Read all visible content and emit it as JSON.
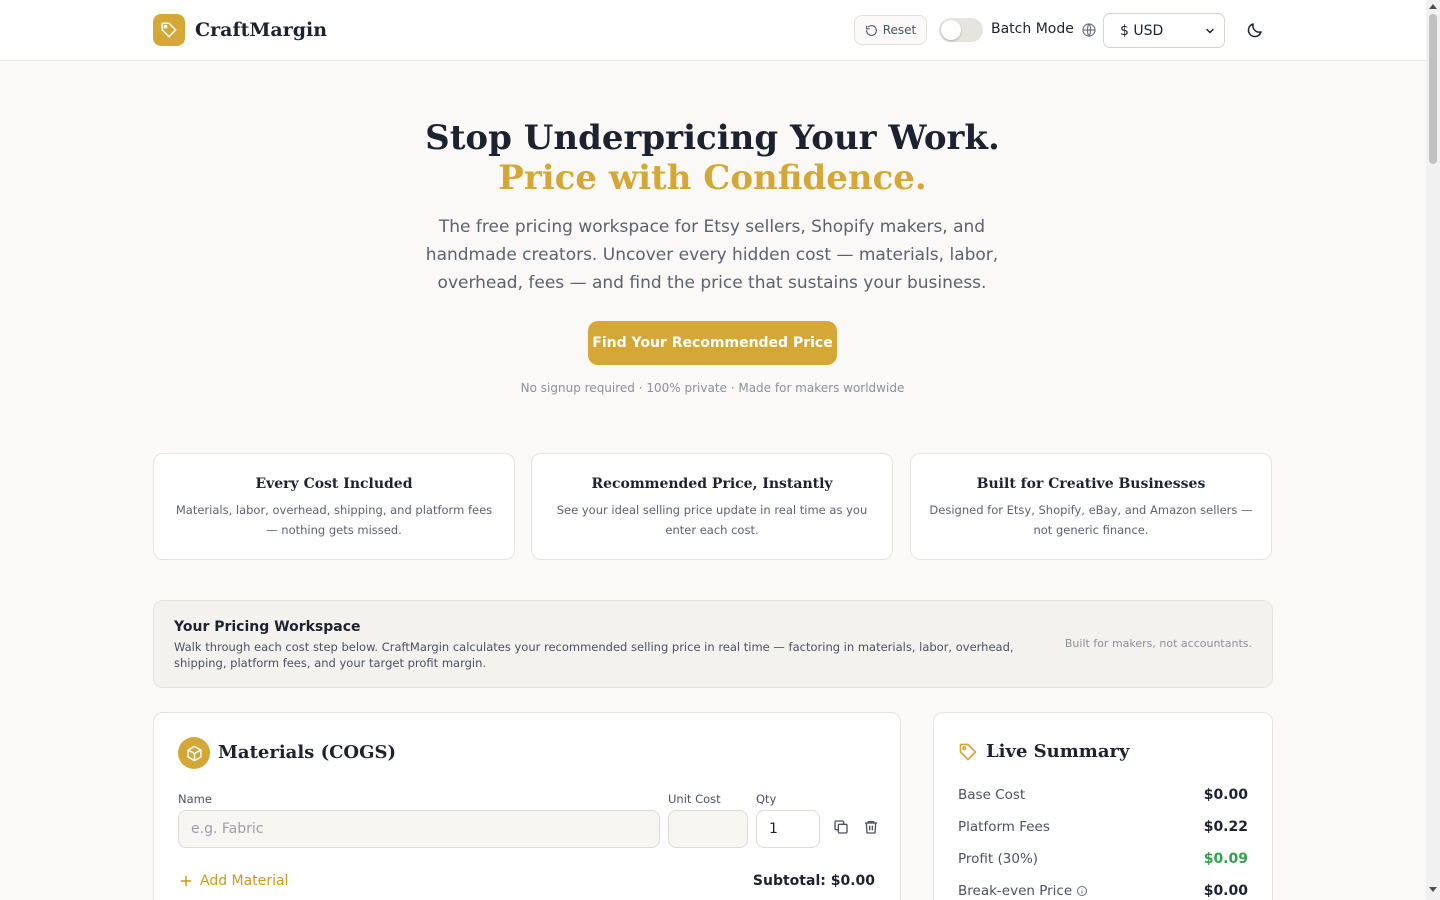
{
  "colors": {
    "accent": "#d4a736",
    "profit_green": "#2fa14f"
  },
  "header": {
    "brand": "CraftMargin",
    "reset_label": "Reset",
    "batch_mode_label": "Batch Mode",
    "currency_value": "$ USD"
  },
  "hero": {
    "title_main": "Stop Underpricing Your Work. ",
    "title_accent": "Price with Confidence.",
    "subtitle": "The free pricing workspace for Etsy sellers, Shopify makers, and handmade creators. Uncover every hidden cost — materials, labor, overhead, fees — and find the price that sustains your business.",
    "cta_label": "Find Your Recommended Price",
    "note": "No signup required · 100% private · Made for makers worldwide"
  },
  "features": [
    {
      "title": "Every Cost Included",
      "text": "Materials, labor, overhead, shipping, and platform fees — nothing gets missed."
    },
    {
      "title": "Recommended Price, Instantly",
      "text": "See your ideal selling price update in real time as you enter each cost."
    },
    {
      "title": "Built for Creative Businesses",
      "text": "Designed for Etsy, Shopify, eBay, and Amazon sellers — not generic finance."
    }
  ],
  "workspace": {
    "title": "Your Pricing Workspace",
    "text": "Walk through each cost step below. CraftMargin calculates your recommended selling price in real time — factoring in materials, labor, overhead, shipping, platform fees, and your target profit margin.",
    "side_note": "Built for makers, not accountants."
  },
  "materials": {
    "title": "Materials (COGS)",
    "name_label": "Name",
    "unit_cost_label": "Unit Cost",
    "qty_label": "Qty",
    "name_placeholder": "e.g. Fabric",
    "unit_cost_value": "",
    "qty_value": "1",
    "add_label": "Add Material",
    "subtotal": "Subtotal: $0.00"
  },
  "summary": {
    "title": "Live Summary",
    "rows": [
      {
        "label": "Base Cost",
        "value": "$0.00"
      },
      {
        "label": "Platform Fees",
        "value": "$0.22"
      },
      {
        "label": "Profit (30%)",
        "value": "$0.09"
      },
      {
        "label": "Break-even Price",
        "value": "$0.00"
      }
    ]
  }
}
